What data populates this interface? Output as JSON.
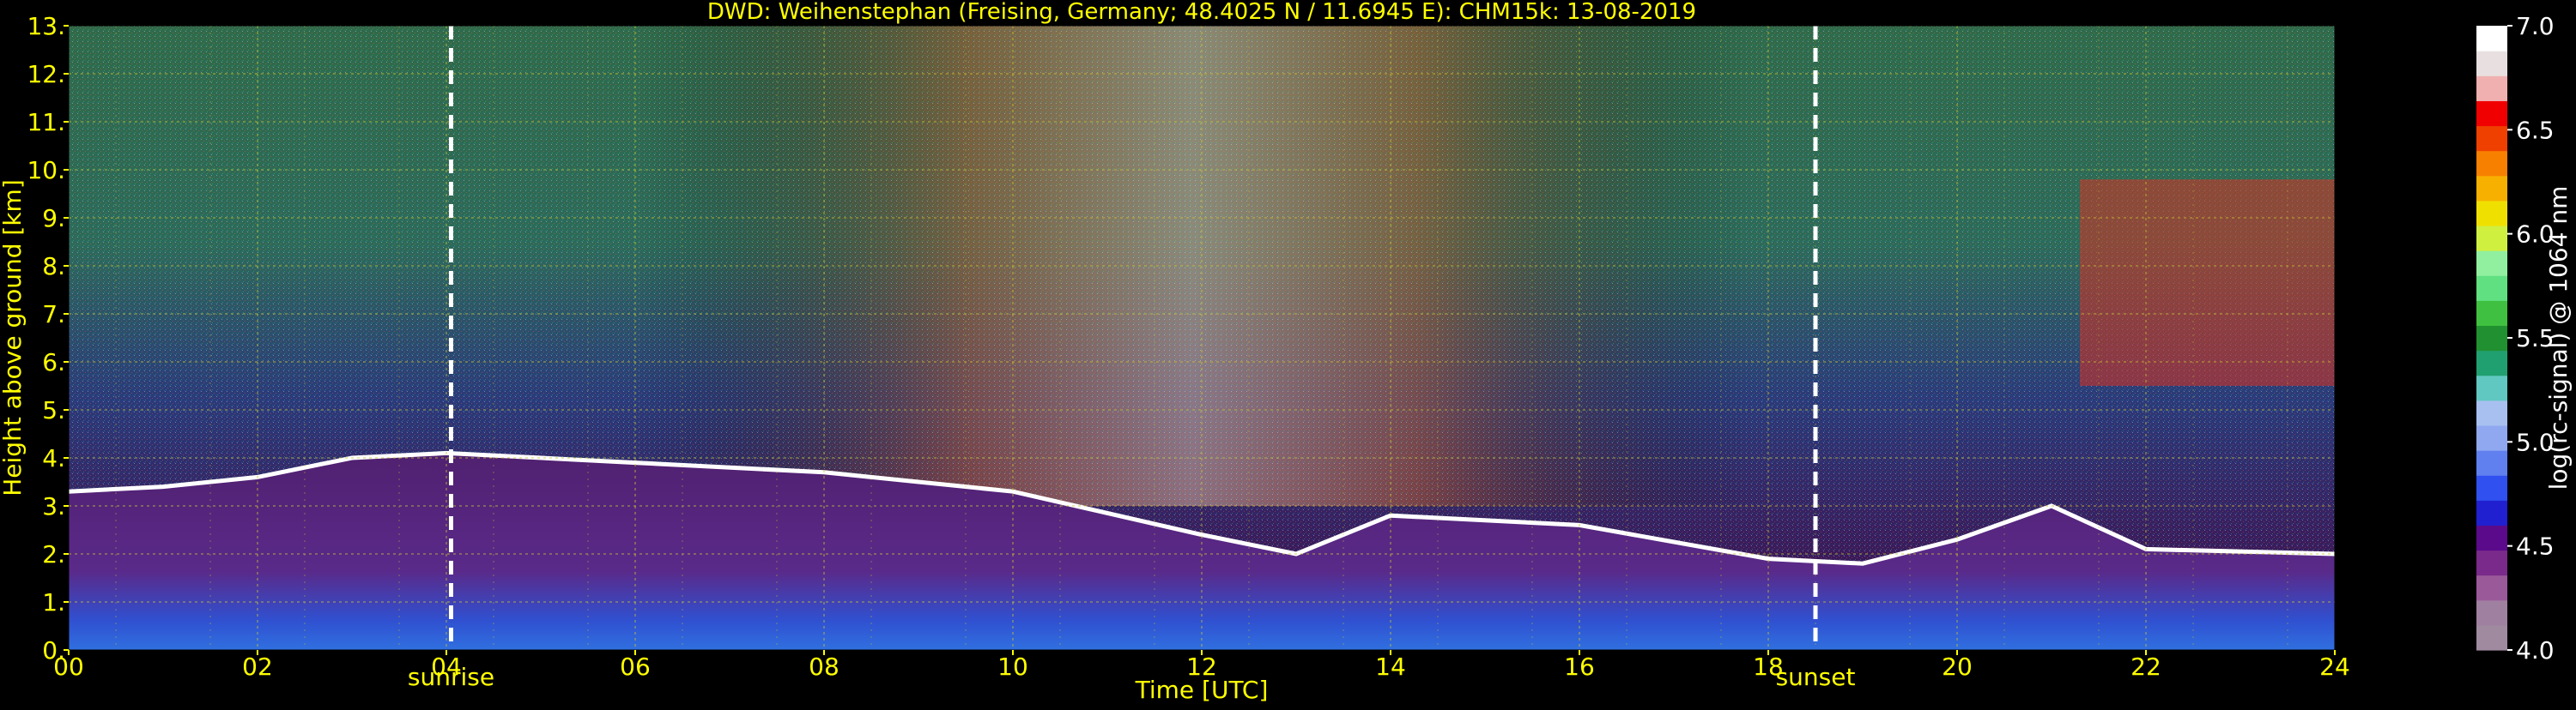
{
  "chart_data": {
    "type": "heatmap",
    "title": "DWD: Weihenstephan (Freising, Germany; 48.4025 N / 11.6945 E):    CHM15k: 13-08-2019",
    "xlabel": "Time [UTC]",
    "ylabel": "Height above ground [km]",
    "xlim": [
      0,
      24
    ],
    "ylim": [
      0,
      13
    ],
    "x_ticks": [
      "00",
      "02",
      "04",
      "06",
      "08",
      "10",
      "12",
      "14",
      "16",
      "18",
      "20",
      "22",
      "24"
    ],
    "x_tick_values": [
      0,
      2,
      4,
      6,
      8,
      10,
      12,
      14,
      16,
      18,
      20,
      22,
      24
    ],
    "y_ticks": [
      "0.",
      "1.",
      "2.",
      "3.",
      "4.",
      "5.",
      "6.",
      "7.",
      "8.",
      "9.",
      "10.",
      "11.",
      "12.",
      "13."
    ],
    "y_tick_values": [
      0,
      1,
      2,
      3,
      4,
      5,
      6,
      7,
      8,
      9,
      10,
      11,
      12,
      13
    ],
    "grid": true,
    "annotations": [
      {
        "label": "sunrise",
        "x": 4.05
      },
      {
        "label": "sunset",
        "x": 18.5
      }
    ],
    "colorbar": {
      "label": "log(rc-signal) @ 1064 nm",
      "range": [
        4.0,
        7.0
      ],
      "ticks": [
        "4.0",
        "4.5",
        "5.0",
        "5.5",
        "6.0",
        "6.5",
        "7.0"
      ],
      "tick_values": [
        4.0,
        4.5,
        5.0,
        5.5,
        6.0,
        6.5,
        7.0
      ]
    },
    "layers": {
      "boundary_layer_top_km": [
        [
          0,
          3.3
        ],
        [
          1,
          3.4
        ],
        [
          2,
          3.6
        ],
        [
          3,
          4.0
        ],
        [
          4,
          4.1
        ],
        [
          6,
          3.9
        ],
        [
          8,
          3.7
        ],
        [
          10,
          3.3
        ],
        [
          12,
          2.4
        ],
        [
          13,
          2.0
        ],
        [
          14,
          2.8
        ],
        [
          16,
          2.6
        ],
        [
          18,
          1.9
        ],
        [
          19,
          1.8
        ],
        [
          20,
          2.3
        ],
        [
          21,
          3.0
        ],
        [
          22,
          2.1
        ],
        [
          24,
          2.0
        ]
      ],
      "cirrus_cloud": {
        "x_start": 21.3,
        "x_end": 24,
        "y_bottom_km": 5.5,
        "y_top_km": 9.8
      }
    },
    "colors": {
      "axis_text": "#ffff00",
      "grid": "#c8c832",
      "annotation_line": "#ffffff",
      "colorbar_label": "#ffffff"
    }
  }
}
